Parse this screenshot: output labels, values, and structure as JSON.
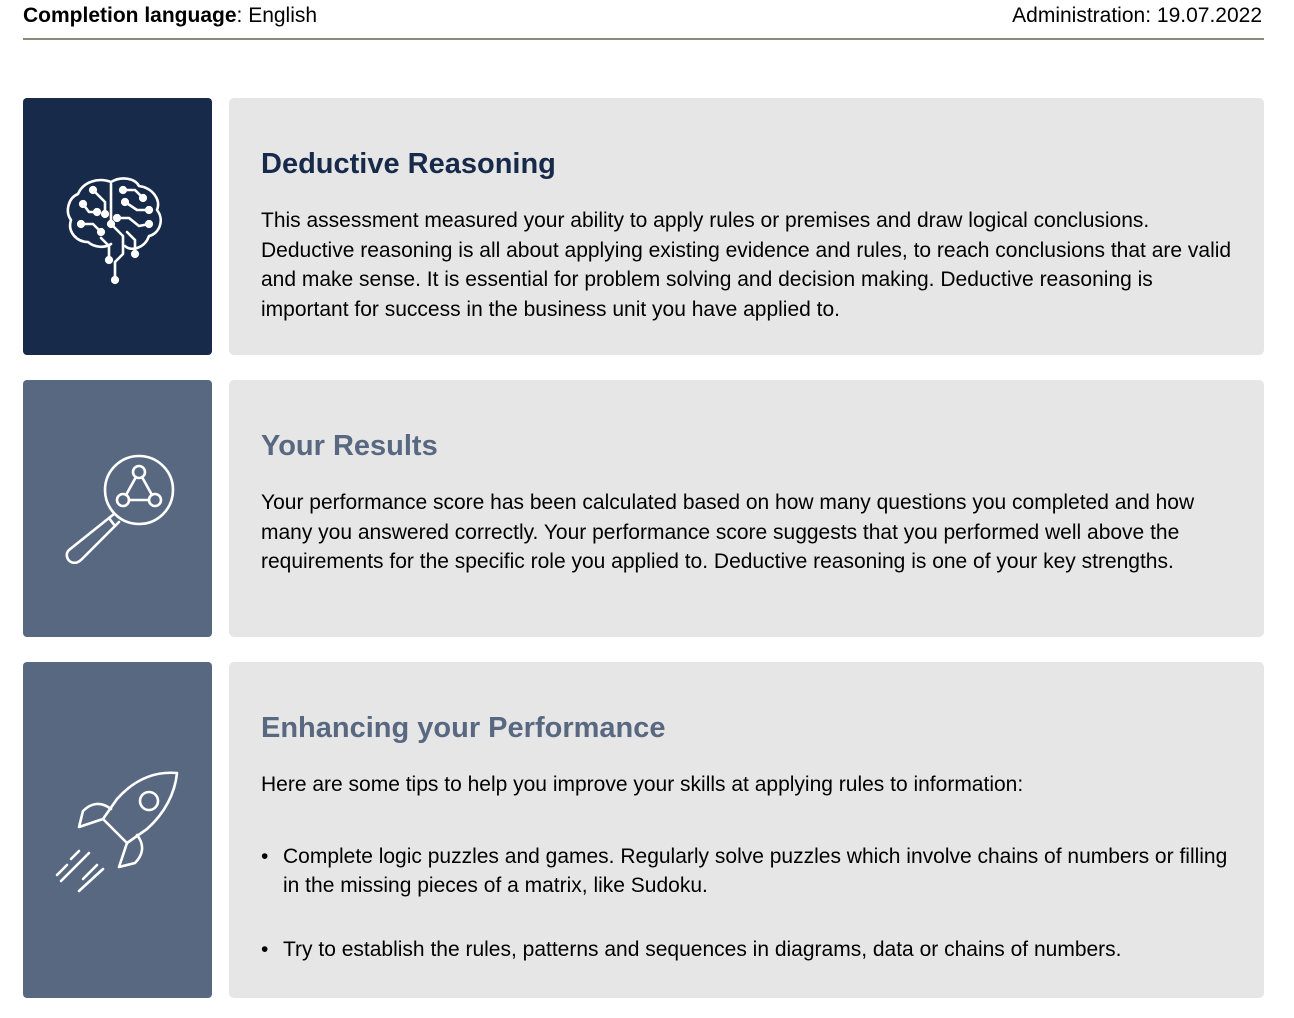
{
  "header": {
    "language_label": "Completion language",
    "language_value": "English",
    "administration_label": "Administration",
    "administration_value": "19.07.2022"
  },
  "colors": {
    "navy": "#172a4a",
    "slate": "#596881",
    "panel": "#e6e6e6"
  },
  "sections": [
    {
      "icon": "brain-circuit-icon",
      "title": "Deductive Reasoning",
      "body": "This assessment measured your ability to apply rules or premises and draw logical conclusions. Deductive reasoning is all about applying existing evidence and rules, to reach conclusions that are valid and make sense. It is essential for problem solving and decision making. Deductive reasoning is important for success in the business unit you have applied to."
    },
    {
      "icon": "magnifier-network-icon",
      "title": "Your Results",
      "body": "Your performance score has been calculated based on how many questions you completed and how many you answered correctly. Your performance score suggests that you performed well above the requirements for the specific role you applied to. Deductive reasoning is one of your key strengths."
    },
    {
      "icon": "rocket-icon",
      "title": "Enhancing your Performance",
      "body": "Here are some tips to help you improve your skills at applying rules to information:",
      "tips": [
        "Complete logic puzzles and games. Regularly solve puzzles which involve chains of numbers or filling in the missing pieces of a matrix, like Sudoku.",
        "Try to establish the rules, patterns and sequences in diagrams, data or chains of numbers."
      ],
      "bullet": "•"
    }
  ]
}
